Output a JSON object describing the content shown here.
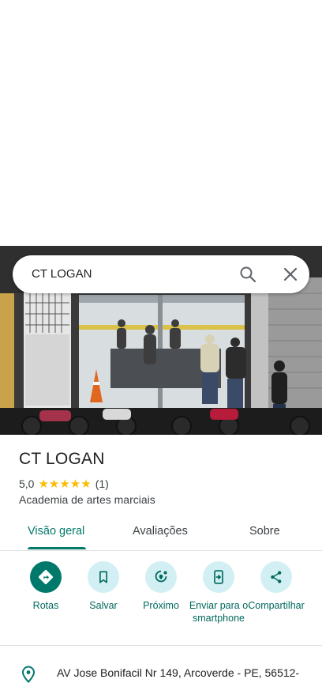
{
  "search": {
    "query": "CT LOGAN"
  },
  "place": {
    "title": "CT LOGAN",
    "rating": "5,0",
    "stars": "★★★★★",
    "review_count": "(1)",
    "category": "Academia de artes marciais"
  },
  "tabs": [
    {
      "label": "Visão geral",
      "active": true
    },
    {
      "label": "Avaliações",
      "active": false
    },
    {
      "label": "Sobre",
      "active": false
    }
  ],
  "actions": [
    {
      "label": "Rotas",
      "icon": "directions-icon"
    },
    {
      "label": "Salvar",
      "icon": "bookmark-icon"
    },
    {
      "label": "Próximo",
      "icon": "nearby-icon"
    },
    {
      "label": "Enviar para o smartphone",
      "icon": "send-to-phone-icon"
    },
    {
      "label": "Compartilhar",
      "icon": "share-icon"
    }
  ],
  "address": "AV Jose Bonifacil Nr 149, Arcoverde - PE, 56512-",
  "colors": {
    "accent": "#00796b",
    "action_bg": "#d2f0f4",
    "stars": "#fbbc04"
  }
}
